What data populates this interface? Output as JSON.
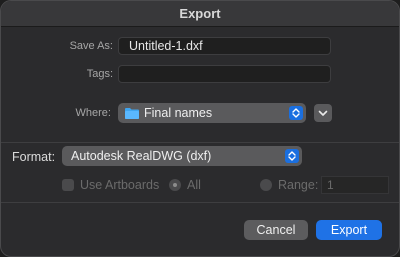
{
  "window": {
    "title": "Export"
  },
  "save_as": {
    "label": "Save As:",
    "value": "Untitled-1.dxf"
  },
  "tags": {
    "label": "Tags:",
    "value": ""
  },
  "where": {
    "label": "Where:",
    "value": "Final names",
    "icon": "folder-icon"
  },
  "format": {
    "label": "Format:",
    "value": "Autodesk RealDWG (dxf)"
  },
  "options": {
    "use_artboards": "Use Artboards",
    "all": "All",
    "range": "Range:",
    "range_value": "1"
  },
  "buttons": {
    "cancel": "Cancel",
    "export": "Export"
  },
  "colors": {
    "accent": "#1f72e6",
    "background": "#2b2b2d"
  }
}
